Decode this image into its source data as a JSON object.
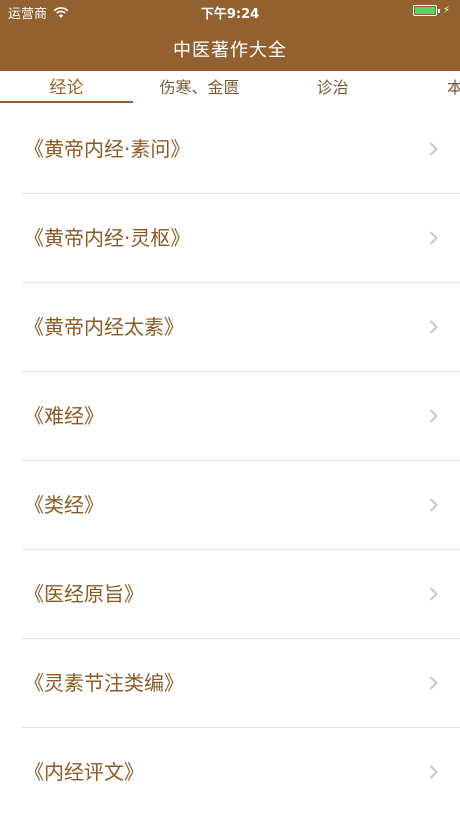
{
  "status_bar": {
    "carrier": "运营商",
    "wifi_icon": "wifi-icon",
    "time": "下午9:24",
    "battery_icon": "battery-icon",
    "battery_color": "#4cd964"
  },
  "nav": {
    "title": "中医著作大全",
    "bar_color": "#93612f"
  },
  "tabs": [
    {
      "label": "经论"
    },
    {
      "label": "伤寒、金匮"
    },
    {
      "label": "诊治"
    },
    {
      "label": "本"
    }
  ],
  "list": {
    "items": [
      {
        "label": "《黄帝内经·素问》"
      },
      {
        "label": "《黄帝内经·灵枢》"
      },
      {
        "label": "《黄帝内经太素》"
      },
      {
        "label": "《难经》"
      },
      {
        "label": "《类经》"
      },
      {
        "label": "《医经原旨》"
      },
      {
        "label": "《灵素节注类编》"
      },
      {
        "label": "《内经评文》"
      }
    ],
    "chevron_icon": "chevron-right-icon",
    "text_color": "#8b5a26"
  }
}
